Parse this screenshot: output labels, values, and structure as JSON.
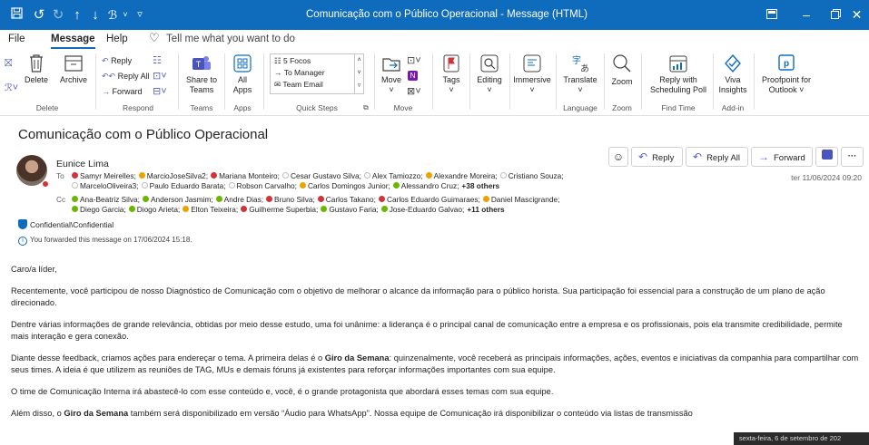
{
  "titlebar": {
    "title": "Comunicação com o Público Operacional  -  Message (HTML)"
  },
  "menu": {
    "file": "File",
    "message": "Message",
    "help": "Help",
    "tell": "Tell me what you want to do"
  },
  "ribbon": {
    "delete": "Delete",
    "archive": "Archive",
    "group_delete": "Delete",
    "reply": "Reply",
    "reply_all": "Reply All",
    "forward": "Forward",
    "group_respond": "Respond",
    "share_line1": "Share to",
    "share_line2": "Teams",
    "group_teams": "Teams",
    "all_apps_line1": "All",
    "all_apps_line2": "Apps",
    "group_apps": "Apps",
    "qs1": "5 Focos",
    "qs2": "To Manager",
    "qs3": "Team Email",
    "group_quicksteps": "Quick Steps",
    "move": "Move",
    "group_move": "Move",
    "tags": "Tags",
    "editing": "Editing",
    "immersive": "Immersive",
    "translate": "Translate",
    "group_language": "Language",
    "zoom": "Zoom",
    "group_zoom": "Zoom",
    "poll_line1": "Reply with",
    "poll_line2": "Scheduling Poll",
    "group_findtime": "Find Time",
    "viva_line1": "Viva",
    "viva_line2": "Insights",
    "group_addin": "Add-in",
    "pp_line1": "Proofpoint for",
    "pp_line2": "Outlook ˅"
  },
  "email": {
    "subject": "Comunicação com o Público Operacional",
    "sender": "Eunice Lima",
    "to_label": "To",
    "cc_label": "Cc",
    "to_line1": [
      {
        "s": "r",
        "n": "Samyr Meirelles;"
      },
      {
        "s": "y",
        "n": "MarcioJoseSilva2;"
      },
      {
        "s": "r",
        "n": "Mariana Monteiro;"
      },
      {
        "s": "e",
        "n": "Cesar Gustavo Silva;"
      },
      {
        "s": "e",
        "n": "Alex Tamiozzo;"
      },
      {
        "s": "y",
        "n": "Alexandre Moreira;"
      },
      {
        "s": "e",
        "n": "Cristiano Souza;"
      }
    ],
    "to_line2": [
      {
        "s": "e",
        "n": "MarceloOliveira3;"
      },
      {
        "s": "e",
        "n": "Paulo Eduardo Barata;"
      },
      {
        "s": "e",
        "n": "Robson Carvalho;"
      },
      {
        "s": "y",
        "n": "Carlos Domingos Junior;"
      },
      {
        "s": "g",
        "n": "Alessandro Cruz;"
      }
    ],
    "to_more": "+38 others",
    "cc_line1": [
      {
        "s": "g",
        "n": "Ana-Beatriz Silva;"
      },
      {
        "s": "g",
        "n": "Anderson Jasmim;"
      },
      {
        "s": "g",
        "n": "Andre Dias;"
      },
      {
        "s": "r",
        "n": "Bruno Silva;"
      },
      {
        "s": "r",
        "n": "Carlos Takano;"
      },
      {
        "s": "r",
        "n": "Carlos Eduardo Guimaraes;"
      },
      {
        "s": "y",
        "n": "Daniel Mascigrande;"
      }
    ],
    "cc_line2": [
      {
        "s": "g",
        "n": "Diego Garcia;"
      },
      {
        "s": "g",
        "n": "Diogo Arieta;"
      },
      {
        "s": "y",
        "n": "Elton Teixeira;"
      },
      {
        "s": "r",
        "n": "Guilherme Superbia;"
      },
      {
        "s": "g",
        "n": "Gustavo Faria;"
      },
      {
        "s": "g",
        "n": "Jose-Eduardo Galvao;"
      }
    ],
    "cc_more": "+11 others",
    "date": "ter 11/06/2024 09:20",
    "reply": "Reply",
    "reply_all": "Reply All",
    "forward": "Forward",
    "confidential": "Confidential\\Confidential",
    "forwarded": "You forwarded this message on 17/06/2024 15:18.",
    "greeting": "Caro/a líder,",
    "p1": "Recentemente, você participou de nosso Diagnóstico de Comunicação com o objetivo de melhorar o alcance da informação para o público horista. Sua participação foi essencial para a construção de um plano de ação direcionado.",
    "p2": "Dentre várias informações de grande relevância, obtidas por meio desse estudo, uma foi unânime: a liderança é o principal canal de comunicação entre a empresa e os profissionais, pois ela transmite credibilidade, permite mais interação e gera conexão.",
    "p3_a": "Diante desse feedback, criamos ações para endereçar o tema. A primeira delas é o ",
    "p3_b": "Giro da Semana",
    "p3_c": ": quinzenalmente, você receberá as principais informações, ações, eventos e iniciativas da companhia para compartilhar com seus times. A ideia é que utilizem as reuniões de TAG, MUs e demais fóruns já existentes para reforçar informações importantes com sua equipe.",
    "p4": "O time de Comunicação Interna irá abastecê-lo com esse conteúdo e, você, é o grande protagonista que abordará esses temas com sua equipe.",
    "p5_a": "Além disso, o ",
    "p5_b": "Giro da Semana",
    "p5_c": " também será disponibilizado em versão “Áudio para WhatsApp”. Nossa equipe de Comunicação irá disponibilizar o conteúdo via listas de transmissão",
    "tooltip": "sexta-feira, 6 de setembro de 202"
  }
}
